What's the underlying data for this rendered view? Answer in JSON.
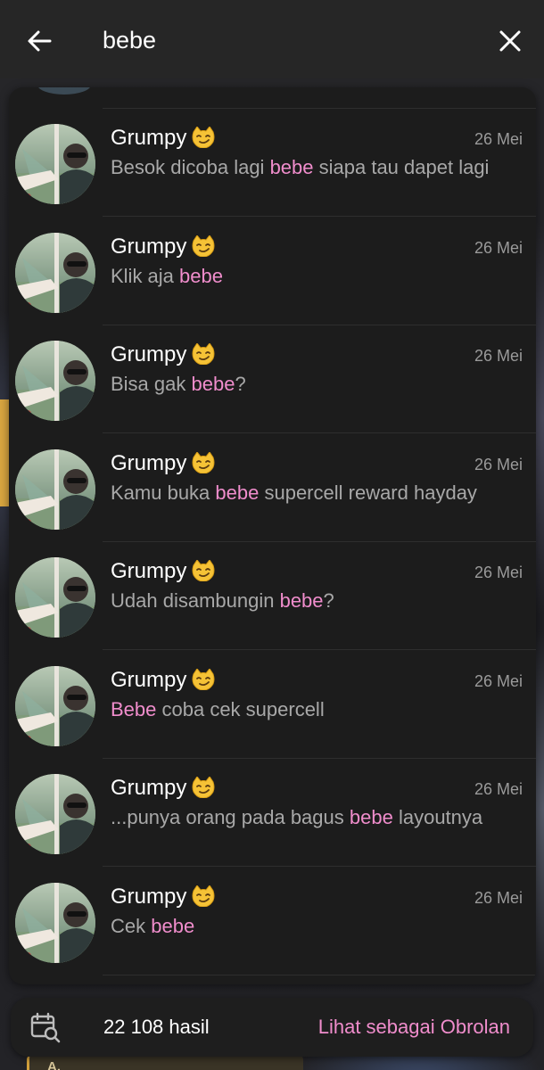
{
  "search": {
    "query": "bebe",
    "back_icon": "arrow-left-icon",
    "close_icon": "close-icon"
  },
  "colors": {
    "highlight": "#f08dcc",
    "background": "#1c1c1c",
    "topbar": "#262626"
  },
  "results": [
    {
      "name": "Grumpy",
      "emoji": "smirking-cat-emoji",
      "date": "26 Mei",
      "message": [
        {
          "text": "Besok dicoba lagi ",
          "highlight": false
        },
        {
          "text": "bebe",
          "highlight": true
        },
        {
          "text": " siapa tau dapet lagi",
          "highlight": false
        }
      ]
    },
    {
      "name": "Grumpy",
      "emoji": "smirking-cat-emoji",
      "date": "26 Mei",
      "message": [
        {
          "text": "Klik aja ",
          "highlight": false
        },
        {
          "text": "bebe",
          "highlight": true
        }
      ]
    },
    {
      "name": "Grumpy",
      "emoji": "smirking-cat-emoji",
      "date": "26 Mei",
      "message": [
        {
          "text": "Bisa gak ",
          "highlight": false
        },
        {
          "text": "bebe",
          "highlight": true
        },
        {
          "text": "?",
          "highlight": false
        }
      ]
    },
    {
      "name": "Grumpy",
      "emoji": "smirking-cat-emoji",
      "date": "26 Mei",
      "message": [
        {
          "text": "Kamu buka ",
          "highlight": false
        },
        {
          "text": "bebe",
          "highlight": true
        },
        {
          "text": " supercell reward hayday",
          "highlight": false
        }
      ]
    },
    {
      "name": "Grumpy",
      "emoji": "smirking-cat-emoji",
      "date": "26 Mei",
      "message": [
        {
          "text": "Udah disambungin ",
          "highlight": false
        },
        {
          "text": "bebe",
          "highlight": true
        },
        {
          "text": "?",
          "highlight": false
        }
      ]
    },
    {
      "name": "Grumpy",
      "emoji": "smirking-cat-emoji",
      "date": "26 Mei",
      "message": [
        {
          "text": "Bebe",
          "highlight": true
        },
        {
          "text": " coba cek supercell",
          "highlight": false
        }
      ]
    },
    {
      "name": "Grumpy",
      "emoji": "smirking-cat-emoji",
      "date": "26 Mei",
      "message": [
        {
          "text": "...punya orang pada bagus ",
          "highlight": false
        },
        {
          "text": "bebe",
          "highlight": true
        },
        {
          "text": " layoutnya",
          "highlight": false
        }
      ]
    },
    {
      "name": "Grumpy",
      "emoji": "smirking-cat-emoji",
      "date": "26 Mei",
      "message": [
        {
          "text": "Cek ",
          "highlight": false
        },
        {
          "text": "bebe",
          "highlight": true
        }
      ]
    }
  ],
  "background_chat": {
    "snippet": "A."
  },
  "bottom_bar": {
    "calendar_icon": "calendar-search-icon",
    "count": "22 108 hasil",
    "view_as_chat": "Lihat sebagai Obrolan"
  }
}
